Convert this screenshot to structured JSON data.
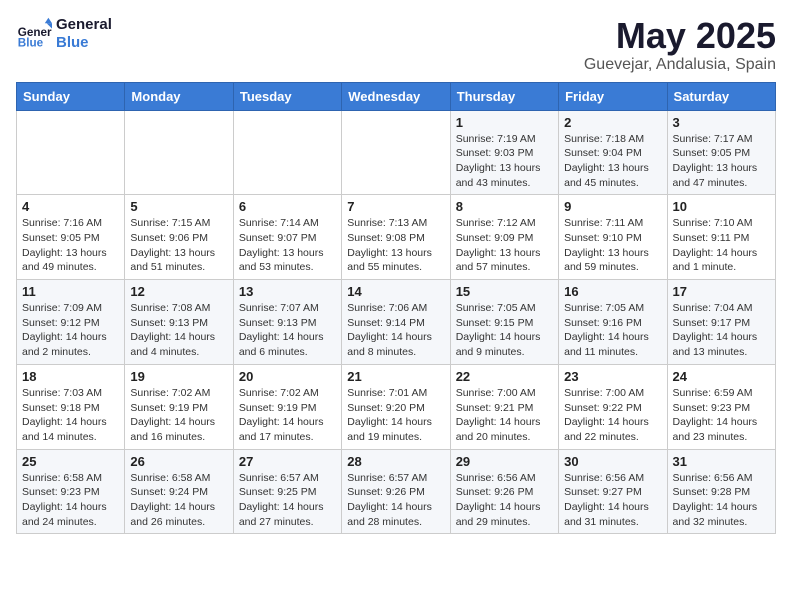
{
  "logo": {
    "line1": "General",
    "line2": "Blue"
  },
  "title": "May 2025",
  "subtitle": "Guevejar, Andalusia, Spain",
  "days_of_week": [
    "Sunday",
    "Monday",
    "Tuesday",
    "Wednesday",
    "Thursday",
    "Friday",
    "Saturday"
  ],
  "weeks": [
    [
      {
        "num": "",
        "info": ""
      },
      {
        "num": "",
        "info": ""
      },
      {
        "num": "",
        "info": ""
      },
      {
        "num": "",
        "info": ""
      },
      {
        "num": "1",
        "info": "Sunrise: 7:19 AM\nSunset: 9:03 PM\nDaylight: 13 hours\nand 43 minutes."
      },
      {
        "num": "2",
        "info": "Sunrise: 7:18 AM\nSunset: 9:04 PM\nDaylight: 13 hours\nand 45 minutes."
      },
      {
        "num": "3",
        "info": "Sunrise: 7:17 AM\nSunset: 9:05 PM\nDaylight: 13 hours\nand 47 minutes."
      }
    ],
    [
      {
        "num": "4",
        "info": "Sunrise: 7:16 AM\nSunset: 9:05 PM\nDaylight: 13 hours\nand 49 minutes."
      },
      {
        "num": "5",
        "info": "Sunrise: 7:15 AM\nSunset: 9:06 PM\nDaylight: 13 hours\nand 51 minutes."
      },
      {
        "num": "6",
        "info": "Sunrise: 7:14 AM\nSunset: 9:07 PM\nDaylight: 13 hours\nand 53 minutes."
      },
      {
        "num": "7",
        "info": "Sunrise: 7:13 AM\nSunset: 9:08 PM\nDaylight: 13 hours\nand 55 minutes."
      },
      {
        "num": "8",
        "info": "Sunrise: 7:12 AM\nSunset: 9:09 PM\nDaylight: 13 hours\nand 57 minutes."
      },
      {
        "num": "9",
        "info": "Sunrise: 7:11 AM\nSunset: 9:10 PM\nDaylight: 13 hours\nand 59 minutes."
      },
      {
        "num": "10",
        "info": "Sunrise: 7:10 AM\nSunset: 9:11 PM\nDaylight: 14 hours\nand 1 minute."
      }
    ],
    [
      {
        "num": "11",
        "info": "Sunrise: 7:09 AM\nSunset: 9:12 PM\nDaylight: 14 hours\nand 2 minutes."
      },
      {
        "num": "12",
        "info": "Sunrise: 7:08 AM\nSunset: 9:13 PM\nDaylight: 14 hours\nand 4 minutes."
      },
      {
        "num": "13",
        "info": "Sunrise: 7:07 AM\nSunset: 9:13 PM\nDaylight: 14 hours\nand 6 minutes."
      },
      {
        "num": "14",
        "info": "Sunrise: 7:06 AM\nSunset: 9:14 PM\nDaylight: 14 hours\nand 8 minutes."
      },
      {
        "num": "15",
        "info": "Sunrise: 7:05 AM\nSunset: 9:15 PM\nDaylight: 14 hours\nand 9 minutes."
      },
      {
        "num": "16",
        "info": "Sunrise: 7:05 AM\nSunset: 9:16 PM\nDaylight: 14 hours\nand 11 minutes."
      },
      {
        "num": "17",
        "info": "Sunrise: 7:04 AM\nSunset: 9:17 PM\nDaylight: 14 hours\nand 13 minutes."
      }
    ],
    [
      {
        "num": "18",
        "info": "Sunrise: 7:03 AM\nSunset: 9:18 PM\nDaylight: 14 hours\nand 14 minutes."
      },
      {
        "num": "19",
        "info": "Sunrise: 7:02 AM\nSunset: 9:19 PM\nDaylight: 14 hours\nand 16 minutes."
      },
      {
        "num": "20",
        "info": "Sunrise: 7:02 AM\nSunset: 9:19 PM\nDaylight: 14 hours\nand 17 minutes."
      },
      {
        "num": "21",
        "info": "Sunrise: 7:01 AM\nSunset: 9:20 PM\nDaylight: 14 hours\nand 19 minutes."
      },
      {
        "num": "22",
        "info": "Sunrise: 7:00 AM\nSunset: 9:21 PM\nDaylight: 14 hours\nand 20 minutes."
      },
      {
        "num": "23",
        "info": "Sunrise: 7:00 AM\nSunset: 9:22 PM\nDaylight: 14 hours\nand 22 minutes."
      },
      {
        "num": "24",
        "info": "Sunrise: 6:59 AM\nSunset: 9:23 PM\nDaylight: 14 hours\nand 23 minutes."
      }
    ],
    [
      {
        "num": "25",
        "info": "Sunrise: 6:58 AM\nSunset: 9:23 PM\nDaylight: 14 hours\nand 24 minutes."
      },
      {
        "num": "26",
        "info": "Sunrise: 6:58 AM\nSunset: 9:24 PM\nDaylight: 14 hours\nand 26 minutes."
      },
      {
        "num": "27",
        "info": "Sunrise: 6:57 AM\nSunset: 9:25 PM\nDaylight: 14 hours\nand 27 minutes."
      },
      {
        "num": "28",
        "info": "Sunrise: 6:57 AM\nSunset: 9:26 PM\nDaylight: 14 hours\nand 28 minutes."
      },
      {
        "num": "29",
        "info": "Sunrise: 6:56 AM\nSunset: 9:26 PM\nDaylight: 14 hours\nand 29 minutes."
      },
      {
        "num": "30",
        "info": "Sunrise: 6:56 AM\nSunset: 9:27 PM\nDaylight: 14 hours\nand 31 minutes."
      },
      {
        "num": "31",
        "info": "Sunrise: 6:56 AM\nSunset: 9:28 PM\nDaylight: 14 hours\nand 32 minutes."
      }
    ]
  ]
}
